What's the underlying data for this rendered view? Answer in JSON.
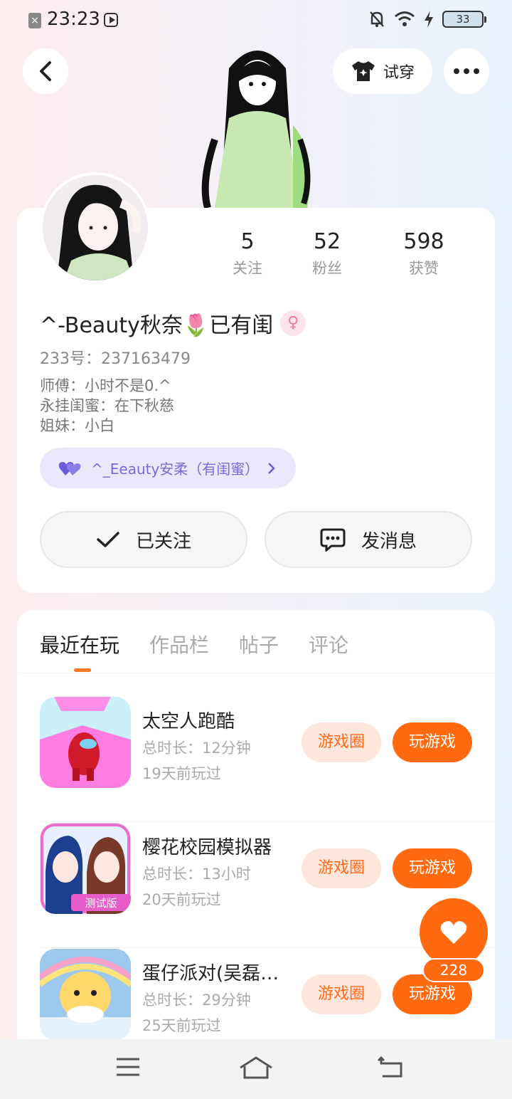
{
  "status_bar": {
    "time": "23:23",
    "battery": "33",
    "notif_icon": "x-icon"
  },
  "header": {
    "try_on_label": "试穿"
  },
  "profile": {
    "stats": [
      {
        "num": "5",
        "label": "关注"
      },
      {
        "num": "52",
        "label": "粉丝"
      },
      {
        "num": "598",
        "label": "获赞"
      }
    ],
    "nickname": "^-Beauty秋奈🌷已有闺",
    "gender_symbol": "♀",
    "uid": "233号：237163479",
    "bio": [
      "师傅：小时不是0.^",
      "永挂闺蜜：在下秋慈",
      "姐妹：小白"
    ],
    "bestie_label": "^_Eeauty安柔（有闺蜜）",
    "follow_label": "已关注",
    "message_label": "发消息"
  },
  "tabs": [
    "最近在玩",
    "作品栏",
    "帖子",
    "评论"
  ],
  "games": [
    {
      "name": "太空人跑酷",
      "duration": "总时长：12分钟",
      "last": "19天前玩过",
      "circle_label": "游戏圈",
      "play_label": "玩游戏"
    },
    {
      "name": "樱花校园模拟器",
      "duration": "总时长：13小时",
      "last": "20天前玩过",
      "circle_label": "游戏圈",
      "play_label": "玩游戏"
    },
    {
      "name": "蛋仔派对(吴磊代言)",
      "duration": "总时长：29分钟",
      "last": "25天前玩过",
      "circle_label": "游戏圈",
      "play_label": "玩游戏"
    }
  ],
  "game_icon_badge": "测试版",
  "like_count": "228",
  "colors": {
    "accent": "#ff6a10",
    "accent_light": "#fde7dc",
    "bestie_bg": "#ebe8fb"
  }
}
